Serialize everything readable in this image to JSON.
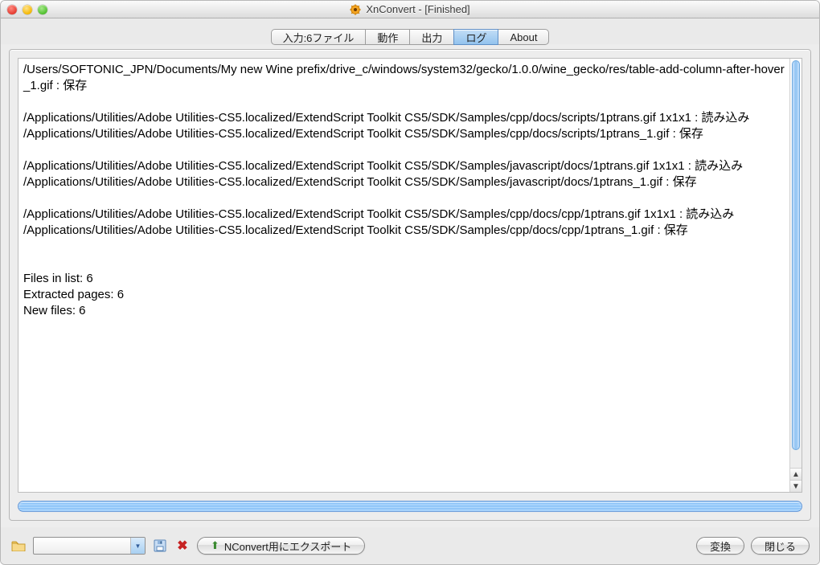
{
  "window": {
    "title": "XnConvert - [Finished]"
  },
  "tabs": [
    {
      "label": "入力:6ファイル"
    },
    {
      "label": "動作"
    },
    {
      "label": "出力"
    },
    {
      "label": "ログ"
    },
    {
      "label": "About"
    }
  ],
  "log": {
    "text": "/Users/SOFTONIC_JPN/Documents/My new Wine prefix/drive_c/windows/system32/gecko/1.0.0/wine_gecko/res/table-add-column-after-hover_1.gif : 保存\n\n/Applications/Utilities/Adobe Utilities-CS5.localized/ExtendScript Toolkit CS5/SDK/Samples/cpp/docs/scripts/1ptrans.gif 1x1x1 : 読み込み\n/Applications/Utilities/Adobe Utilities-CS5.localized/ExtendScript Toolkit CS5/SDK/Samples/cpp/docs/scripts/1ptrans_1.gif : 保存\n\n/Applications/Utilities/Adobe Utilities-CS5.localized/ExtendScript Toolkit CS5/SDK/Samples/javascript/docs/1ptrans.gif 1x1x1 : 読み込み\n/Applications/Utilities/Adobe Utilities-CS5.localized/ExtendScript Toolkit CS5/SDK/Samples/javascript/docs/1ptrans_1.gif : 保存\n\n/Applications/Utilities/Adobe Utilities-CS5.localized/ExtendScript Toolkit CS5/SDK/Samples/cpp/docs/cpp/1ptrans.gif 1x1x1 : 読み込み\n/Applications/Utilities/Adobe Utilities-CS5.localized/ExtendScript Toolkit CS5/SDK/Samples/cpp/docs/cpp/1ptrans_1.gif : 保存\n\n\nFiles in list: 6\nExtracted pages: 6\nNew files: 6"
  },
  "toolbar": {
    "preset_value": "",
    "export_label": "NConvert用にエクスポート",
    "convert_label": "変換",
    "close_label": "閉じる"
  }
}
